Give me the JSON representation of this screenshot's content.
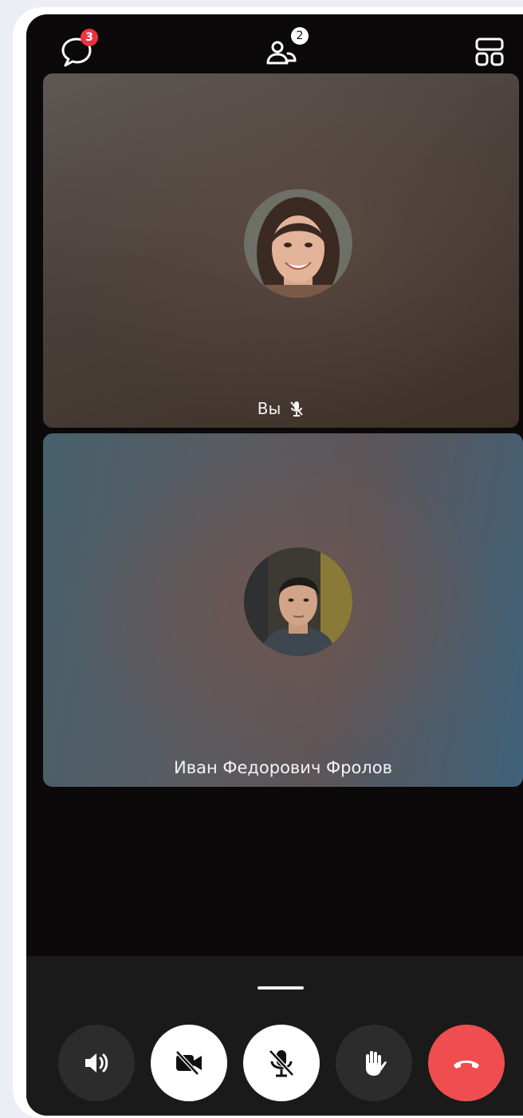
{
  "top_bar": {
    "chat_badge": "3",
    "participants_badge": "2"
  },
  "tiles": [
    {
      "name": "Вы",
      "mic_muted": true
    },
    {
      "name": "Иван Федорович Фролов",
      "mic_muted": false
    }
  ],
  "controls": {
    "icons": [
      "speaker-icon",
      "video-off-icon",
      "mic-off-icon",
      "raise-hand-icon",
      "hang-up-icon"
    ],
    "end_call_color": "#ef4d4f"
  },
  "colors": {
    "badge_red": "#ee3340",
    "screen_bg": "#0b0909",
    "panel_bg": "#1b1a1a"
  }
}
